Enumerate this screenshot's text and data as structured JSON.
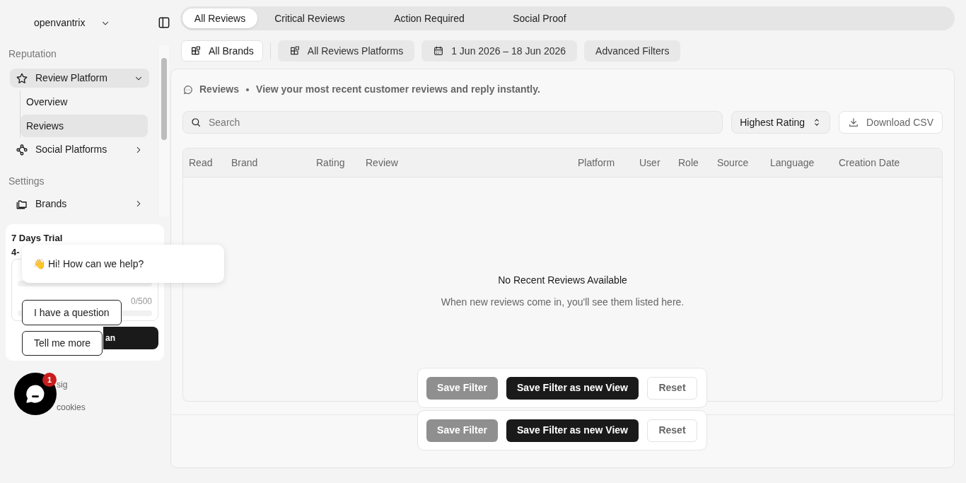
{
  "workspace": {
    "name": "openvantrix"
  },
  "tabs": [
    {
      "label": "All Reviews",
      "selected": true
    },
    {
      "label": "Critical Reviews",
      "selected": false
    },
    {
      "label": "Action Required",
      "selected": false
    },
    {
      "label": "Social Proof",
      "selected": false
    }
  ],
  "sidebar": {
    "sections": [
      {
        "title": "Reputation",
        "items": [
          {
            "label": "Review Platform",
            "expanded": true,
            "selected": true,
            "children": [
              {
                "label": "Overview",
                "selected": false
              },
              {
                "label": "Reviews",
                "selected": true
              }
            ]
          },
          {
            "label": "Social Platforms",
            "expanded": false,
            "selected": false
          }
        ]
      },
      {
        "title": "Settings",
        "items": [
          {
            "label": "Brands",
            "expanded": false,
            "selected": false
          }
        ]
      }
    ],
    "trial": {
      "title": "7 Days Trial",
      "subtitle": "4-",
      "usage": [
        {
          "reading": "0/500"
        }
      ],
      "button": "an"
    },
    "footer_links": [
      "sig",
      "cookies"
    ]
  },
  "filters": [
    {
      "label": "All Brands",
      "kind": "outline"
    },
    {
      "label": "All Reviews Platforms",
      "kind": "filled"
    },
    {
      "label": "1 Jun 2026 – 18 Jun 2026",
      "kind": "filled"
    },
    {
      "label": "Advanced Filters",
      "kind": "filled"
    }
  ],
  "panel": {
    "title": "Reviews",
    "description": "View your most recent customer reviews and reply instantly.",
    "search": {
      "placeholder": "Search"
    },
    "sort": "Highest Rating",
    "download": "Download CSV",
    "table": {
      "columns": [
        "Read",
        "Brand",
        "Rating",
        "Review",
        "Platform",
        "User",
        "Role",
        "Source",
        "Language",
        "Creation Date"
      ],
      "empty_title": "No Recent Reviews Available",
      "empty_text": "When new reviews come in, you'll see them listed here."
    }
  },
  "filter_bars": [
    {
      "buttons": [
        {
          "label": "Save Filter",
          "kind": "secondary",
          "disabled": true
        },
        {
          "label": "Save Filter as new View",
          "kind": "primary",
          "disabled": false
        },
        {
          "label": "Reset",
          "kind": "outline",
          "disabled": false
        }
      ]
    },
    {
      "buttons": [
        {
          "label": "Save Filter",
          "kind": "secondary",
          "disabled": true
        },
        {
          "label": "Save Filter as new View",
          "kind": "primary",
          "disabled": false
        },
        {
          "label": "Reset",
          "kind": "outline",
          "disabled": false
        }
      ]
    }
  ],
  "chat": {
    "greeting": "👋 Hi! How can we help?",
    "options": [
      "I have a question",
      "Tell me more"
    ],
    "badge": "1"
  }
}
